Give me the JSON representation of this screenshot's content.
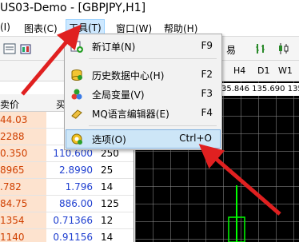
{
  "window": {
    "title": "US03-Demo - [GBPJPY,H1]"
  },
  "menubar": [
    {
      "label": "(I)"
    },
    {
      "label": "图表(C)"
    },
    {
      "label": "工具(T)",
      "active": true
    },
    {
      "label": "窗口(W)"
    },
    {
      "label": "帮助(H)"
    }
  ],
  "toolbar": {
    "partial_label": "易"
  },
  "timeframes": [
    "H4",
    "D1",
    "W1"
  ],
  "market_watch": {
    "headers": [
      "卖价",
      "买"
    ],
    "rows": [
      {
        "bid": "44.03",
        "ask": "4",
        "spread": ""
      },
      {
        "bid": "2288",
        "ask": "2",
        "spread": ""
      },
      {
        "bid": "0.350",
        "ask": "110.600",
        "spread": "250"
      },
      {
        "bid": "8965",
        "ask": "2.8990",
        "spread": "25"
      },
      {
        "bid": ".782",
        "ask": "1.796",
        "spread": "14"
      },
      {
        "bid": "84.75",
        "ask": "886.00",
        "spread": "125"
      },
      {
        "bid": "1354",
        "ask": "0.71366",
        "spread": "12"
      },
      {
        "bid": "1140",
        "ask": "0.91156",
        "spread": "14"
      }
    ]
  },
  "chart": {
    "price_line": "35.846 135.690 135.7"
  },
  "tools_menu": {
    "items": [
      {
        "label": "新订单(N)",
        "shortcut": "F9",
        "icon": "new-order-icon"
      },
      {
        "label": "历史数据中心(H)",
        "shortcut": "F2",
        "icon": "history-center-icon"
      },
      {
        "label": "全局变量(V)",
        "shortcut": "F3",
        "icon": "global-variables-icon"
      },
      {
        "label": "MQ语言编辑器(E)",
        "shortcut": "F4",
        "icon": "metaeditor-icon"
      },
      {
        "label": "选项(O)",
        "shortcut": "Ctrl+O",
        "icon": "options-icon",
        "highlighted": true
      }
    ]
  },
  "colors": {
    "bid_text": "#d04000",
    "ask_text": "#1f3fd0",
    "sell_highlight": "#fde3cf",
    "chart_bg": "#000000",
    "candle_green": "#00ff00",
    "annotation_red": "#e02020",
    "menu_highlight": "#cde6f7"
  }
}
